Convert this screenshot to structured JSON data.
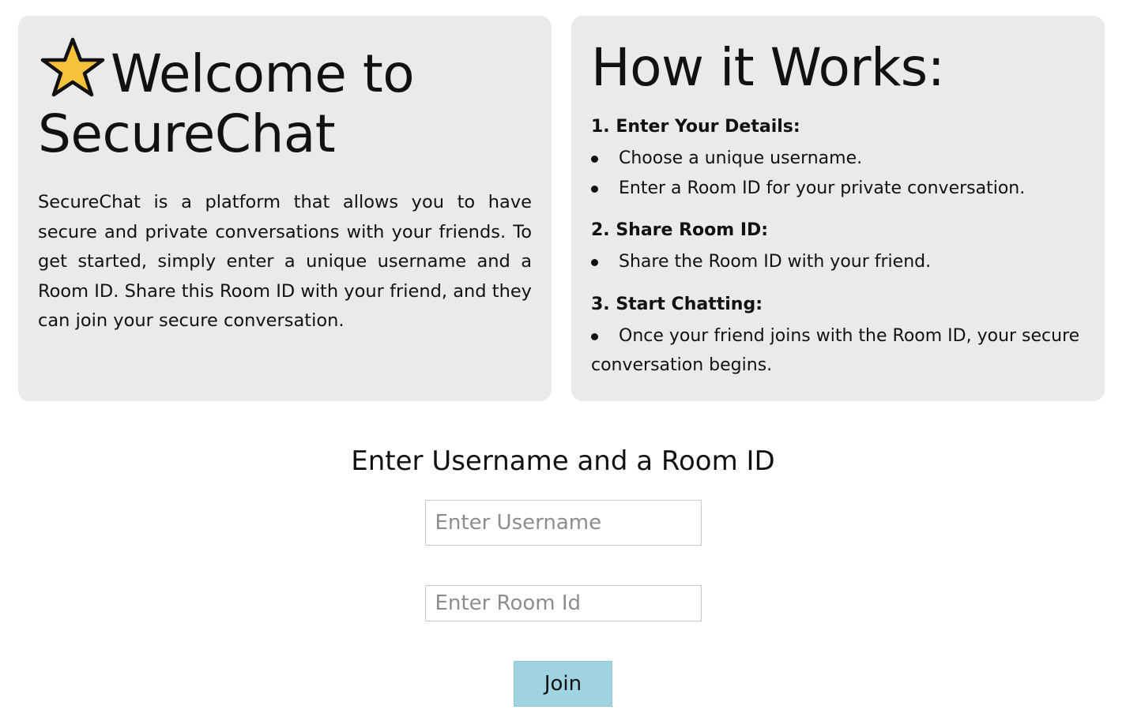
{
  "welcome": {
    "icon": "star-icon",
    "title": "Welcome to SecureChat",
    "description": "SecureChat is a platform that allows you to have secure and private conversations with your friends. To get started, simply enter a unique username and a Room ID. Share this Room ID with your friend, and they can join your secure conversation."
  },
  "how_it_works": {
    "title": "How it Works:",
    "steps": [
      {
        "heading": "1. Enter Your Details:",
        "items": [
          "Choose a unique username.",
          "Enter a Room ID for your private conversation."
        ]
      },
      {
        "heading": "2. Share Room ID:",
        "items": [
          "Share the Room ID with your friend."
        ]
      },
      {
        "heading": "3. Start Chatting:",
        "items": [
          "Once your friend joins with the Room ID, your secure conversation begins."
        ]
      }
    ]
  },
  "join_form": {
    "heading": "Enter Username and a Room ID",
    "username_placeholder": "Enter Username",
    "username_value": "",
    "room_placeholder": "Enter Room Id",
    "room_value": "",
    "join_label": "Join"
  },
  "colors": {
    "card_background": "#e9eaec",
    "button_background": "#9fd3e1",
    "star_fill": "#f6c23c"
  }
}
